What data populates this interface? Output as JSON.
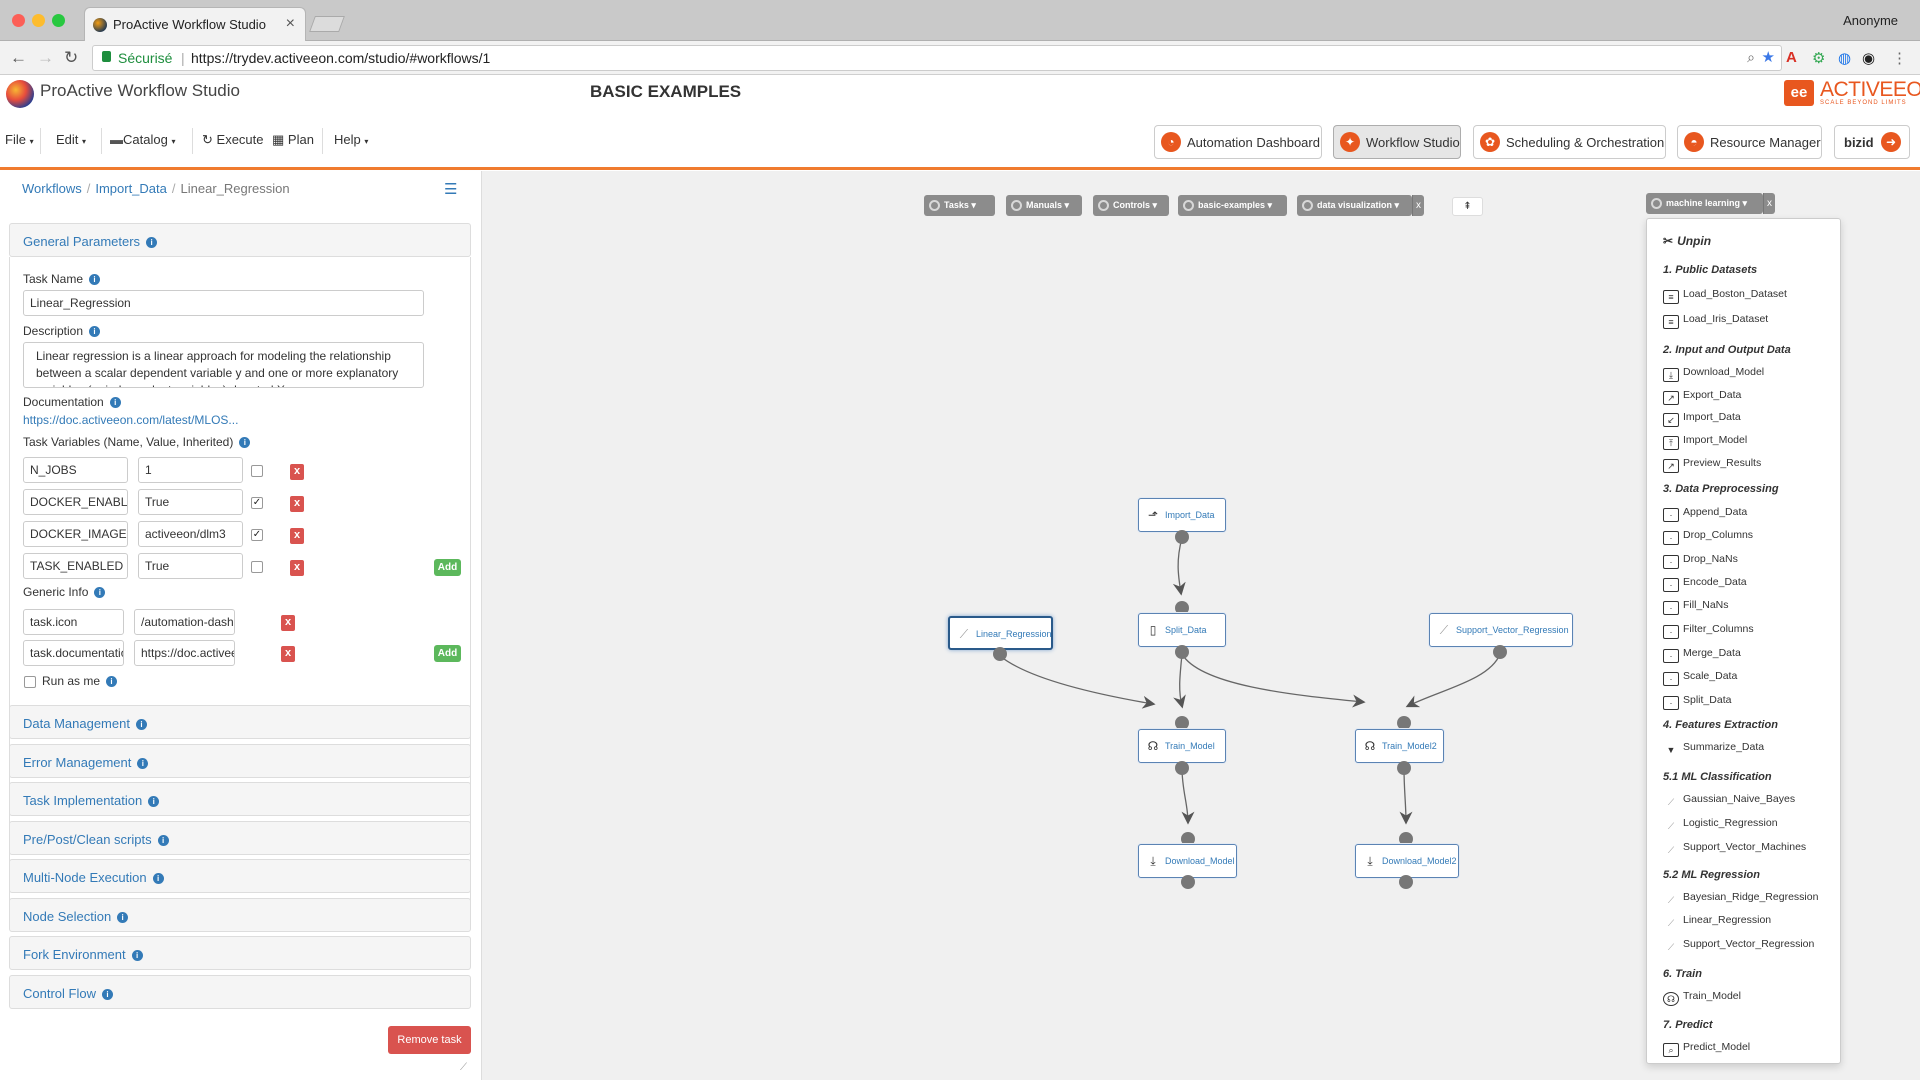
{
  "browser": {
    "tab_title": "ProActive Workflow Studio",
    "user": "Anonyme",
    "secure_label": "Sécurisé",
    "url": "https://trydev.activeeon.com/studio/#workflows/1"
  },
  "app": {
    "title": "ProActive Workflow Studio",
    "workflow_name": "BASIC EXAMPLES",
    "brand_name": "ACTIVEEON",
    "brand_tagline": "SCALE BEYOND LIMITS",
    "brand_mark": "ee"
  },
  "menu": {
    "file": "File",
    "edit": "Edit",
    "catalog": "Catalog",
    "execute": "Execute",
    "plan": "Plan",
    "help": "Help"
  },
  "portals": [
    {
      "label": "Automation Dashboard"
    },
    {
      "label": "Workflow Studio"
    },
    {
      "label": "Scheduling & Orchestration"
    },
    {
      "label": "Resource Manager"
    },
    {
      "label": "bizid"
    }
  ],
  "breadcrumb": {
    "root": "Workflows",
    "parent": "Import_Data",
    "current": "Linear_Regression"
  },
  "general": {
    "header": "General Parameters",
    "task_name_label": "Task Name",
    "task_name": "Linear_Regression",
    "description_label": "Description",
    "description": "Linear regression is a linear approach for modeling the relationship between a scalar dependent variable y and one or more explanatory variables (or independent variables) denoted X.",
    "documentation_label": "Documentation",
    "documentation_link": "https://doc.activeeon.com/latest/MLOS...",
    "task_variables_label": "Task Variables (Name, Value, Inherited)",
    "variables": [
      {
        "name": "N_JOBS",
        "value": "1",
        "inherited": false
      },
      {
        "name": "DOCKER_ENABLED",
        "value": "True",
        "inherited": true
      },
      {
        "name": "DOCKER_IMAGE",
        "value": "activeeon/dlm3",
        "inherited": true
      },
      {
        "name": "TASK_ENABLED",
        "value": "True",
        "inherited": false
      }
    ],
    "generic_info_label": "Generic Info",
    "generic_info": [
      {
        "name": "task.icon",
        "value": "/automation-dashboard"
      },
      {
        "name": "task.documentation",
        "value": "https://doc.activeeon.com"
      }
    ],
    "add_label": "Add",
    "delete_label": "x",
    "run_as_me_label": "Run as me"
  },
  "sections": [
    "Data Management",
    "Error Management",
    "Task Implementation",
    "Pre/Post/Clean scripts",
    "Multi-Node Execution",
    "Node Selection",
    "Fork Environment",
    "Control Flow"
  ],
  "remove_task": "Remove task",
  "palette": {
    "tasks": "Tasks",
    "manuals": "Manuals",
    "controls": "Controls",
    "basic_examples": "basic-examples",
    "data_visualization": "data visualization",
    "machine_learning": "machine learning",
    "close": "x"
  },
  "tasks": {
    "import_data": "Import_Data",
    "split_data": "Split_Data",
    "linear_regression": "Linear_Regression",
    "support_vector_regression": "Support_Vector_Regression",
    "train_model": "Train_Model",
    "train_model2": "Train_Model2",
    "download_model": "Download_Model",
    "download_model2": "Download_Model2"
  },
  "ml_menu": {
    "unpin": "Unpin",
    "groups": [
      {
        "title": "1. Public Datasets",
        "items": [
          "Load_Boston_Dataset",
          "Load_Iris_Dataset"
        ]
      },
      {
        "title": "2. Input and Output Data",
        "items": [
          "Download_Model",
          "Export_Data",
          "Import_Data",
          "Import_Model",
          "Preview_Results"
        ]
      },
      {
        "title": "3. Data Preprocessing",
        "items": [
          "Append_Data",
          "Drop_Columns",
          "Drop_NaNs",
          "Encode_Data",
          "Fill_NaNs",
          "Filter_Columns",
          "Merge_Data",
          "Scale_Data",
          "Split_Data"
        ]
      },
      {
        "title": "4. Features Extraction",
        "items": [
          "Summarize_Data"
        ]
      },
      {
        "title": "5.1 ML Classification",
        "items": [
          "Gaussian_Naive_Bayes",
          "Logistic_Regression",
          "Support_Vector_Machines"
        ]
      },
      {
        "title": "5.2 ML Regression",
        "items": [
          "Bayesian_Ridge_Regression",
          "Linear_Regression",
          "Support_Vector_Regression"
        ]
      },
      {
        "title": "6. Train",
        "items": [
          "Train_Model"
        ]
      },
      {
        "title": "7. Predict",
        "items": [
          "Predict_Model"
        ]
      }
    ]
  }
}
